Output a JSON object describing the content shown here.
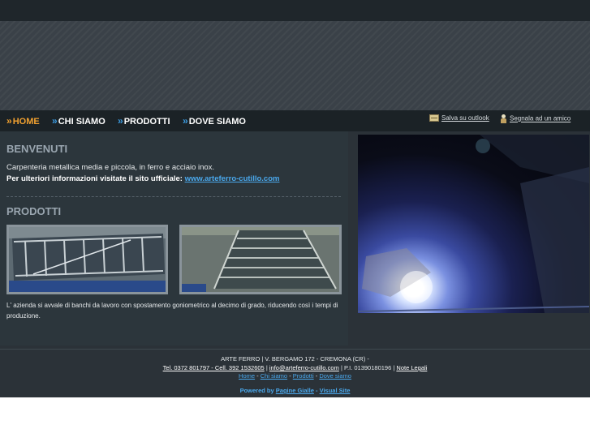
{
  "nav": {
    "items": [
      {
        "label": "HOME",
        "active": true
      },
      {
        "label": "CHI SIAMO",
        "active": false
      },
      {
        "label": "PRODOTTI",
        "active": false
      },
      {
        "label": "DOVE SIAMO",
        "active": false
      }
    ],
    "chevron": "»",
    "util": {
      "outlook": "Salva su outlook",
      "friend": "Segnala ad un amico"
    }
  },
  "welcome": {
    "heading": "BENVENUTI",
    "text": "Carpenteria metallica media e piccola, in ferro e acciaio inox.",
    "more": "Per ulteriori informazioni visitate il sito ufficiale:",
    "link": "www.arteferro-cutillo.com"
  },
  "products": {
    "heading": "PRODOTTI",
    "caption": "L' azienda si avvale  di banchi da lavoro con spostamento goniometrico al decimo di grado, riducendo così i tempi di produzione."
  },
  "footer": {
    "company": "ARTE FERRO | V. BERGAMO 172 - CREMONA (CR) -",
    "phones": "Tel. 0372 801797 - Cell. 392 1532605",
    "email": "info@arteferro-cutillo.com",
    "piva": "P.I. 01390180196",
    "legal": "Note Legali",
    "links": [
      "Home",
      "Chi siamo",
      "Prodotti",
      "Dove siamo"
    ],
    "powered_label": "Powered by",
    "powered_links": [
      "Pagine Gialle",
      "Visual Site"
    ]
  },
  "colors": {
    "accent": "#f0a030",
    "link": "#4aa8ec",
    "background": "#2b3238"
  }
}
